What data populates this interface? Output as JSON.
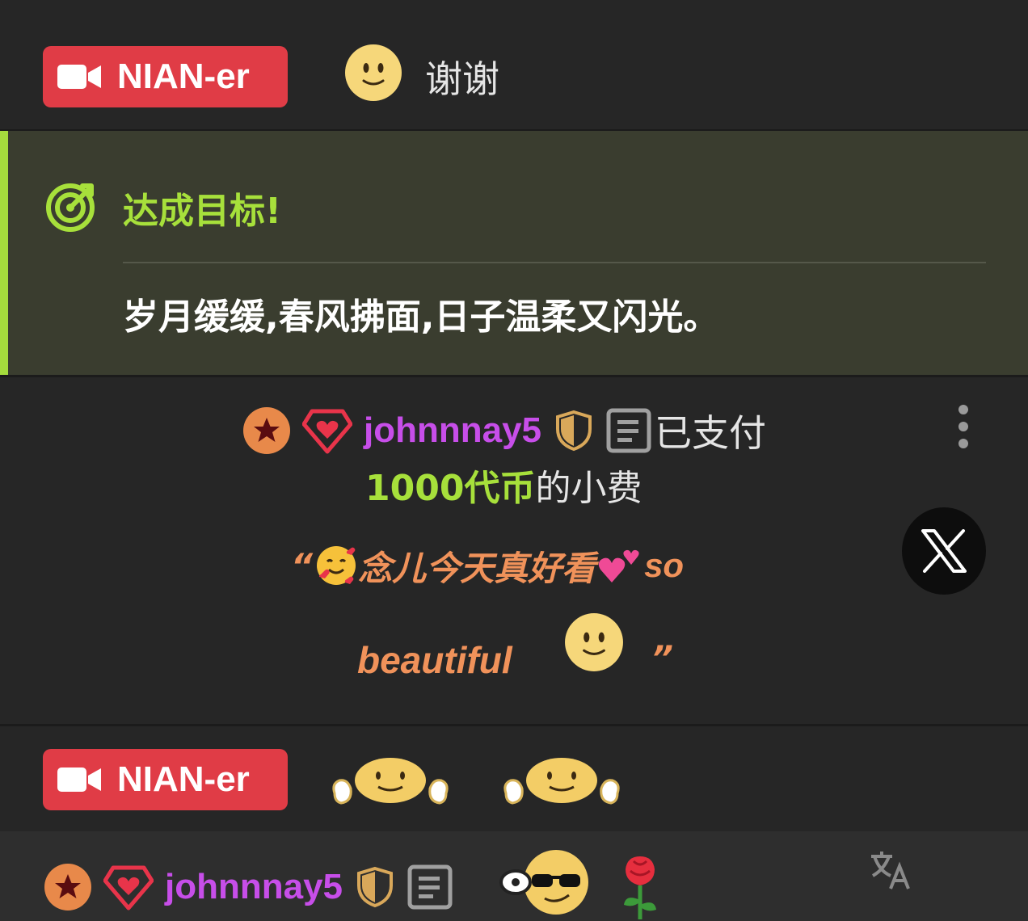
{
  "messages": [
    {
      "badge": "NIAN-er",
      "text": "谢谢"
    },
    {
      "type": "goal",
      "title": "达成目标!",
      "body": "岁月缓缓,春风拂面,日子温柔又闪光。"
    },
    {
      "type": "tip",
      "username": "johnnnay5",
      "paid_label": "已支付",
      "amount": "1000代币",
      "suffix": "的小费",
      "quote_open": "“",
      "quote_text_1": "念儿今天真好看",
      "quote_text_2": "so",
      "quote_text_3": "beautiful",
      "quote_close": "”"
    },
    {
      "badge": "NIAN-er"
    },
    {
      "username": "johnnnay5"
    }
  ],
  "colors": {
    "broadcaster": "#e03c46",
    "goal_accent": "#a7e03b",
    "username": "#c74ee9",
    "tip_quote": "#f0925a",
    "moderator_badge": "#e8894a"
  },
  "icons": [
    "video-camera-icon",
    "target-icon",
    "star-badge-icon",
    "diamond-heart-icon",
    "shield-icon",
    "notes-icon",
    "x-logo-icon",
    "kebab-menu-icon",
    "translate-icon",
    "smiling-face-emoji",
    "hugging-face-emoji",
    "sunglasses-face-emoji",
    "rose-emoji",
    "smiling-hearts-emoji",
    "two-hearts-emoji"
  ]
}
